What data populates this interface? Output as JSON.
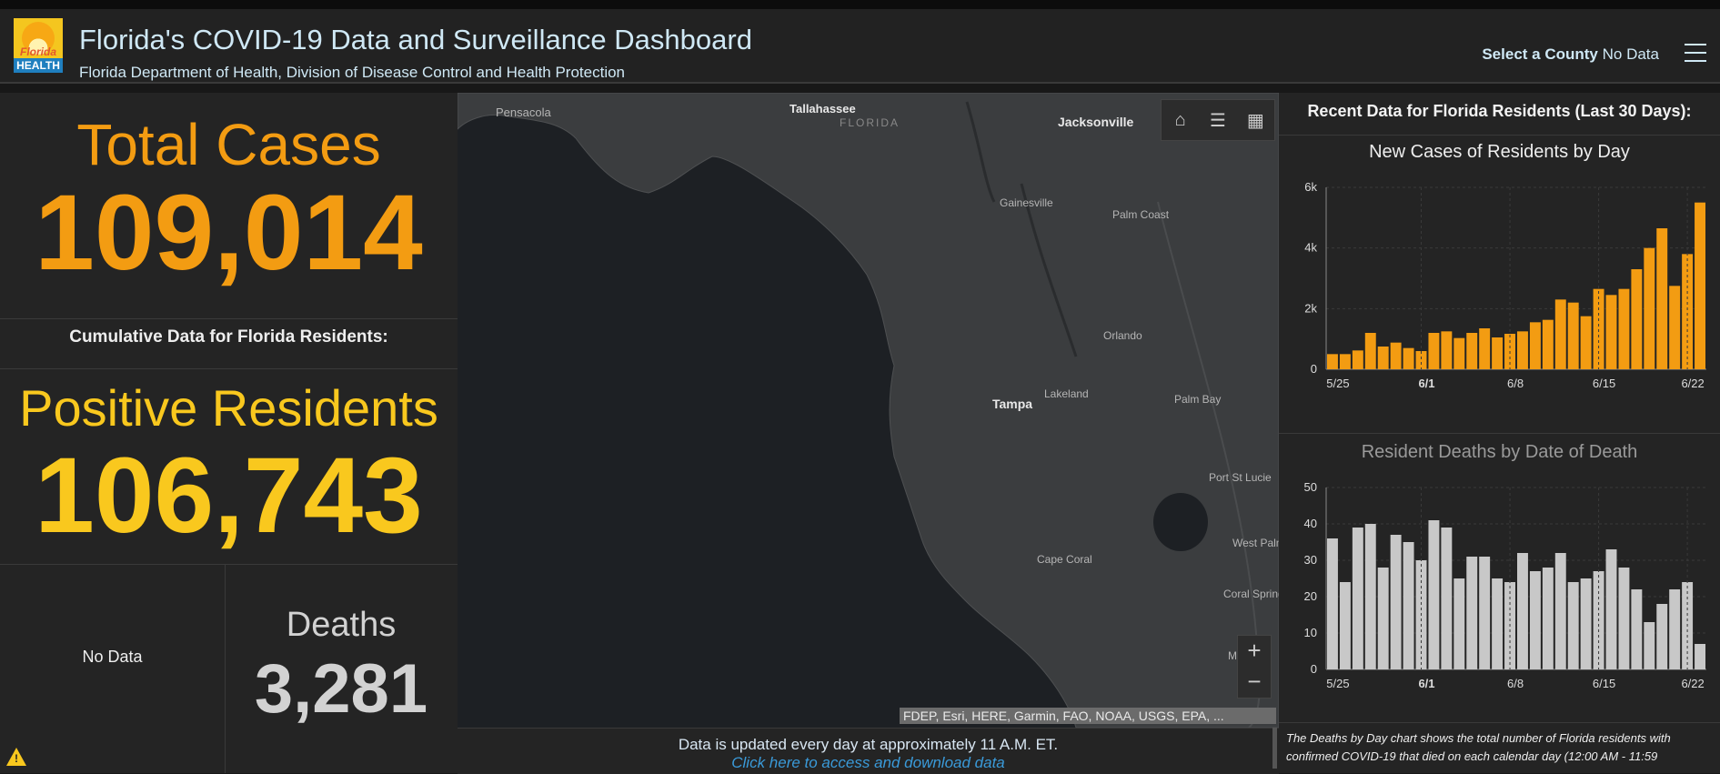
{
  "header": {
    "logo_line1": "Florida",
    "logo_line2": "HEALTH",
    "title": "Florida's COVID-19 Data and Surveillance Dashboard",
    "subtitle": "Florida Department of Health, Division of Disease Control and Health Protection",
    "select_county_label": "Select a County",
    "select_county_value": "No Data"
  },
  "left": {
    "total_cases_label": "Total Cases",
    "total_cases_value": "109,014",
    "cumulative_label": "Cumulative Data for Florida Residents:",
    "positive_residents_label": "Positive Residents",
    "positive_residents_value": "106,743",
    "no_data": "No Data",
    "deaths_label": "Deaths",
    "deaths_value": "3,281"
  },
  "map": {
    "region_label": "FLORIDA",
    "cities": [
      "Pensacola",
      "Tallahassee",
      "Jacksonville",
      "Gainesville",
      "Palm Coast",
      "Orlando",
      "Lakeland",
      "Tampa",
      "Palm Bay",
      "Port St Lucie",
      "West Palm Beach",
      "Cape Coral",
      "Coral Springs",
      "M"
    ],
    "attribution": "FDEP, Esri, HERE, Garmin, FAO, NOAA, USGS, EPA, ...",
    "update_note": "Data is updated every day at approximately 11 A.M. ET.",
    "download_link": "Click here to access and download data"
  },
  "right": {
    "title": "Recent Data for Florida Residents (Last 30 Days):",
    "note": "The Deaths by Day chart shows the total number of Florida residents with confirmed COVID-19 that died on each calendar day (12:00 AM - 11:59"
  },
  "chart_data": [
    {
      "type": "bar",
      "title": "New Cases of Residents by Day",
      "color": "#f39c12",
      "x_tick_labels": [
        "5/25",
        "6/1",
        "6/8",
        "6/15",
        "6/22"
      ],
      "y_tick_labels": [
        "0",
        "2k",
        "4k",
        "6k"
      ],
      "ylim": [
        0,
        6000
      ],
      "values": [
        500,
        500,
        620,
        1200,
        750,
        880,
        700,
        600,
        1200,
        1250,
        1030,
        1200,
        1350,
        1050,
        1170,
        1250,
        1550,
        1630,
        2300,
        2200,
        1750,
        2650,
        2450,
        2650,
        3300,
        4000,
        4650,
        2750,
        3800,
        5500
      ],
      "grid": true
    },
    {
      "type": "bar",
      "title": "Resident Deaths by Date of Death",
      "color": "#c8c8c8",
      "x_tick_labels": [
        "5/25",
        "6/1",
        "6/8",
        "6/15",
        "6/22"
      ],
      "y_tick_labels": [
        "0",
        "10",
        "20",
        "30",
        "40",
        "50"
      ],
      "ylim": [
        0,
        50
      ],
      "values": [
        36,
        24,
        39,
        40,
        28,
        37,
        35,
        30,
        41,
        39,
        25,
        31,
        31,
        25,
        24,
        32,
        27,
        28,
        32,
        24,
        25,
        27,
        33,
        28,
        22,
        13,
        18,
        22,
        24,
        7
      ],
      "grid": true
    }
  ]
}
